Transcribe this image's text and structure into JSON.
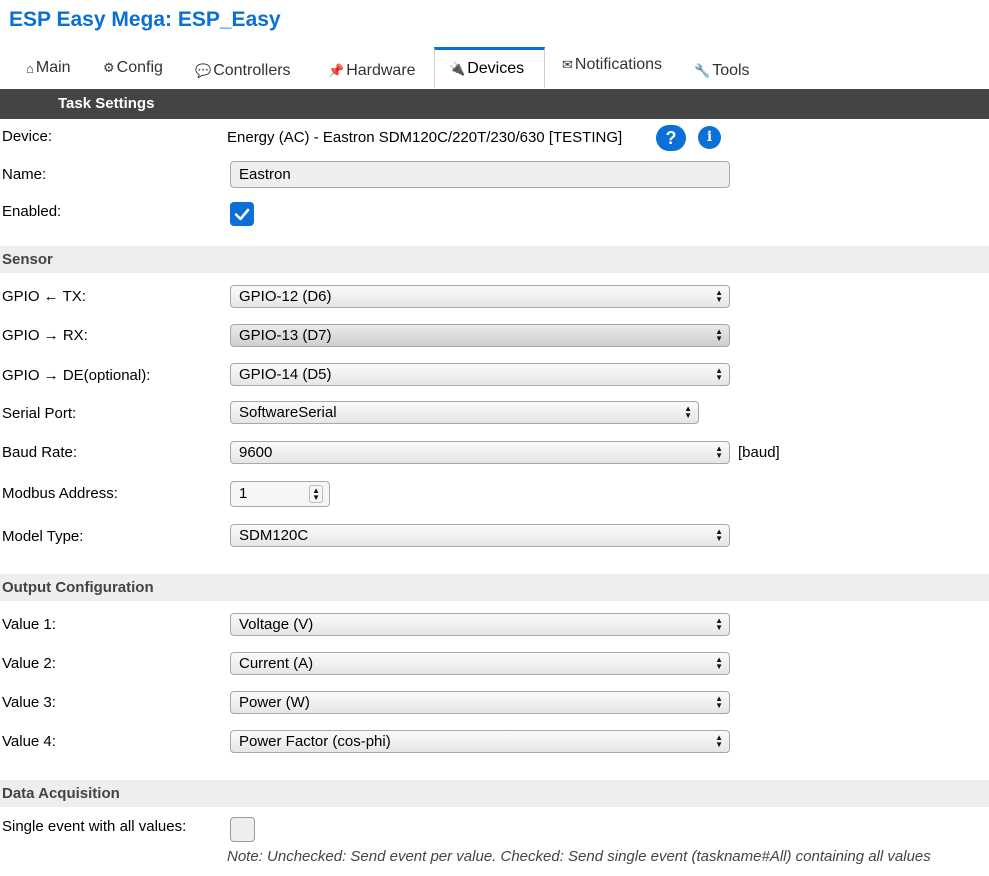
{
  "app": {
    "title": "ESP Easy Mega: ESP_Easy"
  },
  "tabs": [
    {
      "icon": "⌂",
      "label": "Main"
    },
    {
      "icon": "⚙",
      "label": "Config"
    },
    {
      "icon": "💬",
      "label": "Controllers"
    },
    {
      "icon": "📌",
      "label": "Hardware"
    },
    {
      "icon": "🔌",
      "label": "Devices"
    },
    {
      "icon": "✉",
      "label": "Notifications"
    },
    {
      "icon": "🔧",
      "label": "Tools"
    }
  ],
  "active_tab": "Devices",
  "page_heading": "Task Settings",
  "device": {
    "label": "Device:",
    "value": "Energy (AC) - Eastron SDM120C/220T/230/630 [TESTING]",
    "help_icon": "?",
    "info_icon": "i"
  },
  "name": {
    "label": "Name:",
    "value": "Eastron"
  },
  "enabled": {
    "label": "Enabled:",
    "checked": true
  },
  "sections": {
    "sensor": "Sensor",
    "output": "Output Configuration",
    "acquisition": "Data Acquisition"
  },
  "sensor": {
    "gpio_tx": {
      "label": "GPIO ← TX:",
      "value": "GPIO-12 (D6)"
    },
    "gpio_rx": {
      "label": "GPIO → RX:",
      "value": "GPIO-13 (D7)"
    },
    "gpio_de": {
      "label": "GPIO → DE(optional):",
      "value": "GPIO-14 (D5)"
    },
    "serial_port": {
      "label": "Serial Port:",
      "value": "SoftwareSerial"
    },
    "baud_rate": {
      "label": "Baud Rate:",
      "value": "9600",
      "unit": "[baud]"
    },
    "modbus_address": {
      "label": "Modbus Address:",
      "value": "1"
    },
    "model_type": {
      "label": "Model Type:",
      "value": "SDM120C"
    }
  },
  "output": {
    "value1": {
      "label": "Value 1:",
      "value": "Voltage (V)"
    },
    "value2": {
      "label": "Value 2:",
      "value": "Current (A)"
    },
    "value3": {
      "label": "Value 3:",
      "value": "Power (W)"
    },
    "value4": {
      "label": "Value 4:",
      "value": "Power Factor (cos-phi)"
    }
  },
  "acquisition": {
    "single_event": {
      "label": "Single event with all values:",
      "checked": false
    },
    "note": "Note: Unchecked: Send event per value. Checked: Send single event (taskname#All) containing all values"
  },
  "colors": {
    "accent": "#0a6fd6",
    "heading_bg": "#444444",
    "section_bg": "#eeeeee"
  }
}
